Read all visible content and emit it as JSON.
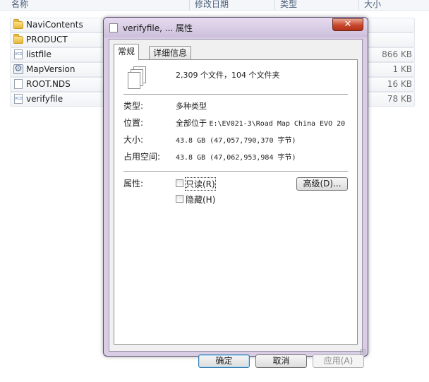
{
  "explorer": {
    "columns": [
      "名称",
      "修改日期",
      "类型",
      "大小"
    ],
    "files": [
      {
        "name": "NaviContents",
        "icon": "folder-icon",
        "size": ""
      },
      {
        "name": "PRODUCT",
        "icon": "folder-icon",
        "size": ""
      },
      {
        "name": "listfile",
        "icon": "vcd-file-icon",
        "size": "866 KB"
      },
      {
        "name": "MapVersion",
        "icon": "settings-file-icon",
        "size": "1 KB"
      },
      {
        "name": "ROOT.NDS",
        "icon": "blank-file-icon",
        "size": "16 KB"
      },
      {
        "name": "verifyfile",
        "icon": "vcd-file-icon",
        "size": "78 KB"
      }
    ]
  },
  "dialog": {
    "title": "verifyfile, ... 属性",
    "close_label": "✕",
    "tabs": {
      "general": "常规",
      "details": "详细信息"
    },
    "summary": "2,309 个文件，104 个文件夹",
    "rows": {
      "type_label": "类型:",
      "type_value": "多种类型",
      "location_label": "位置:",
      "location_value_prefix": "全部位于",
      "location_value_path": "E:\\EV021-3\\Road Map China EVO 20",
      "size_label": "大小:",
      "size_value": "43.8 GB (47,057,790,370 字节)",
      "disk_size_label": "占用空间:",
      "disk_size_value": "43.8 GB (47,062,953,984 字节)"
    },
    "attributes": {
      "label": "属性:",
      "readonly": "只读(R)",
      "hidden": "隐藏(H)",
      "advanced": "高级(D)..."
    },
    "buttons": {
      "ok": "确定",
      "cancel": "取消",
      "apply": "应用(A)"
    }
  }
}
